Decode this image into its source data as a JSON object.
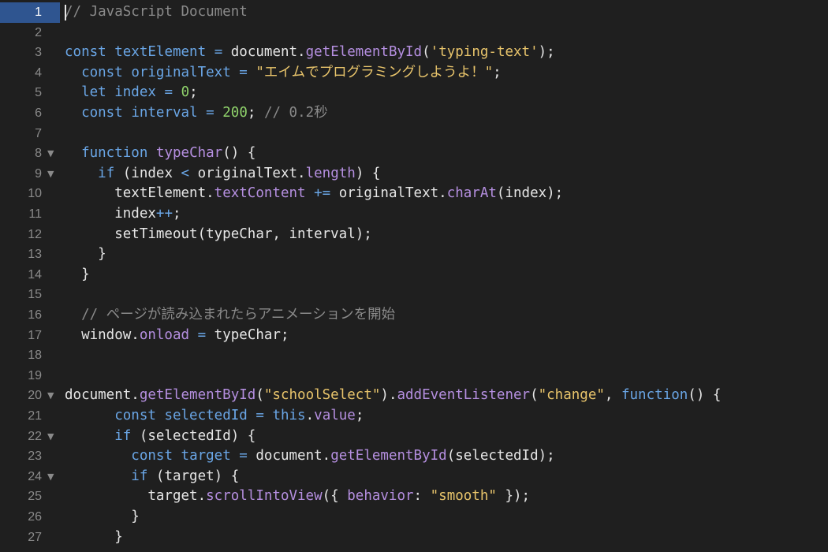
{
  "colors": {
    "background": "#1f1f1f",
    "active_gutter": "#2f5590",
    "keyword": "#6aa6e6",
    "property": "#b58fe0",
    "string": "#e8c46b",
    "number": "#8fd26b",
    "comment": "#8a8a8a",
    "plain": "#e6e6e6"
  },
  "editor": {
    "active_line": 1,
    "lines": [
      {
        "num": "1",
        "fold": "",
        "tokens": [
          [
            "comment",
            "// JavaScript Document"
          ]
        ]
      },
      {
        "num": "2",
        "fold": "",
        "tokens": []
      },
      {
        "num": "3",
        "fold": "",
        "tokens": [
          [
            "kw",
            "const"
          ],
          [
            "plain",
            " "
          ],
          [
            "var",
            "textElement"
          ],
          [
            "plain",
            " "
          ],
          [
            "op",
            "="
          ],
          [
            "plain",
            " document."
          ],
          [
            "prop",
            "getElementById"
          ],
          [
            "plain",
            "("
          ],
          [
            "str",
            "'typing-text'"
          ],
          [
            "plain",
            ");"
          ]
        ]
      },
      {
        "num": "4",
        "fold": "",
        "tokens": [
          [
            "plain",
            "  "
          ],
          [
            "kw",
            "const"
          ],
          [
            "plain",
            " "
          ],
          [
            "var",
            "originalText"
          ],
          [
            "plain",
            " "
          ],
          [
            "op",
            "="
          ],
          [
            "plain",
            " "
          ],
          [
            "str",
            "\"エイムでプログラミングしようよ！\""
          ],
          [
            "plain",
            ";"
          ]
        ]
      },
      {
        "num": "5",
        "fold": "",
        "tokens": [
          [
            "plain",
            "  "
          ],
          [
            "kw",
            "let"
          ],
          [
            "plain",
            " "
          ],
          [
            "var",
            "index"
          ],
          [
            "plain",
            " "
          ],
          [
            "op",
            "="
          ],
          [
            "plain",
            " "
          ],
          [
            "num",
            "0"
          ],
          [
            "plain",
            ";"
          ]
        ]
      },
      {
        "num": "6",
        "fold": "",
        "tokens": [
          [
            "plain",
            "  "
          ],
          [
            "kw",
            "const"
          ],
          [
            "plain",
            " "
          ],
          [
            "var",
            "interval"
          ],
          [
            "plain",
            " "
          ],
          [
            "op",
            "="
          ],
          [
            "plain",
            " "
          ],
          [
            "num",
            "200"
          ],
          [
            "plain",
            "; "
          ],
          [
            "comment",
            "// 0.2秒"
          ]
        ]
      },
      {
        "num": "7",
        "fold": "",
        "tokens": []
      },
      {
        "num": "8",
        "fold": "▼",
        "tokens": [
          [
            "plain",
            "  "
          ],
          [
            "kw",
            "function"
          ],
          [
            "plain",
            " "
          ],
          [
            "prop",
            "typeChar"
          ],
          [
            "plain",
            "() {"
          ]
        ]
      },
      {
        "num": "9",
        "fold": "▼",
        "tokens": [
          [
            "plain",
            "    "
          ],
          [
            "kw",
            "if"
          ],
          [
            "plain",
            " (index "
          ],
          [
            "op",
            "<"
          ],
          [
            "plain",
            " originalText."
          ],
          [
            "prop",
            "length"
          ],
          [
            "plain",
            ") {"
          ]
        ]
      },
      {
        "num": "10",
        "fold": "",
        "tokens": [
          [
            "plain",
            "      textElement."
          ],
          [
            "prop",
            "textContent"
          ],
          [
            "plain",
            " "
          ],
          [
            "op",
            "+="
          ],
          [
            "plain",
            " originalText."
          ],
          [
            "prop",
            "charAt"
          ],
          [
            "plain",
            "(index);"
          ]
        ]
      },
      {
        "num": "11",
        "fold": "",
        "tokens": [
          [
            "plain",
            "      index"
          ],
          [
            "op",
            "++"
          ],
          [
            "plain",
            ";"
          ]
        ]
      },
      {
        "num": "12",
        "fold": "",
        "tokens": [
          [
            "plain",
            "      setTimeout(typeChar, interval);"
          ]
        ]
      },
      {
        "num": "13",
        "fold": "",
        "tokens": [
          [
            "plain",
            "    }"
          ]
        ]
      },
      {
        "num": "14",
        "fold": "",
        "tokens": [
          [
            "plain",
            "  }"
          ]
        ]
      },
      {
        "num": "15",
        "fold": "",
        "tokens": []
      },
      {
        "num": "16",
        "fold": "",
        "tokens": [
          [
            "plain",
            "  "
          ],
          [
            "comment",
            "// ページが読み込まれたらアニメーションを開始"
          ]
        ]
      },
      {
        "num": "17",
        "fold": "",
        "tokens": [
          [
            "plain",
            "  window."
          ],
          [
            "prop",
            "onload"
          ],
          [
            "plain",
            " "
          ],
          [
            "op",
            "="
          ],
          [
            "plain",
            " typeChar;"
          ]
        ]
      },
      {
        "num": "18",
        "fold": "",
        "tokens": []
      },
      {
        "num": "19",
        "fold": "",
        "tokens": []
      },
      {
        "num": "20",
        "fold": "▼",
        "tokens": [
          [
            "plain",
            "document."
          ],
          [
            "prop",
            "getElementById"
          ],
          [
            "plain",
            "("
          ],
          [
            "str",
            "\"schoolSelect\""
          ],
          [
            "plain",
            ")."
          ],
          [
            "prop",
            "addEventListener"
          ],
          [
            "plain",
            "("
          ],
          [
            "str",
            "\"change\""
          ],
          [
            "plain",
            ", "
          ],
          [
            "kw",
            "function"
          ],
          [
            "plain",
            "() {"
          ]
        ]
      },
      {
        "num": "21",
        "fold": "",
        "tokens": [
          [
            "plain",
            "      "
          ],
          [
            "kw",
            "const"
          ],
          [
            "plain",
            " "
          ],
          [
            "var",
            "selectedId"
          ],
          [
            "plain",
            " "
          ],
          [
            "op",
            "="
          ],
          [
            "plain",
            " "
          ],
          [
            "kw",
            "this"
          ],
          [
            "plain",
            "."
          ],
          [
            "prop",
            "value"
          ],
          [
            "plain",
            ";"
          ]
        ]
      },
      {
        "num": "22",
        "fold": "▼",
        "tokens": [
          [
            "plain",
            "      "
          ],
          [
            "kw",
            "if"
          ],
          [
            "plain",
            " (selectedId) {"
          ]
        ]
      },
      {
        "num": "23",
        "fold": "",
        "tokens": [
          [
            "plain",
            "        "
          ],
          [
            "kw",
            "const"
          ],
          [
            "plain",
            " "
          ],
          [
            "var",
            "target"
          ],
          [
            "plain",
            " "
          ],
          [
            "op",
            "="
          ],
          [
            "plain",
            " document."
          ],
          [
            "prop",
            "getElementById"
          ],
          [
            "plain",
            "(selectedId);"
          ]
        ]
      },
      {
        "num": "24",
        "fold": "▼",
        "tokens": [
          [
            "plain",
            "        "
          ],
          [
            "kw",
            "if"
          ],
          [
            "plain",
            " (target) {"
          ]
        ]
      },
      {
        "num": "25",
        "fold": "",
        "tokens": [
          [
            "plain",
            "          target."
          ],
          [
            "prop",
            "scrollIntoView"
          ],
          [
            "plain",
            "({ "
          ],
          [
            "prop",
            "behavior"
          ],
          [
            "plain",
            ": "
          ],
          [
            "str",
            "\"smooth\""
          ],
          [
            "plain",
            " });"
          ]
        ]
      },
      {
        "num": "26",
        "fold": "",
        "tokens": [
          [
            "plain",
            "        }"
          ]
        ]
      },
      {
        "num": "27",
        "fold": "",
        "tokens": [
          [
            "plain",
            "      }"
          ]
        ]
      }
    ]
  }
}
